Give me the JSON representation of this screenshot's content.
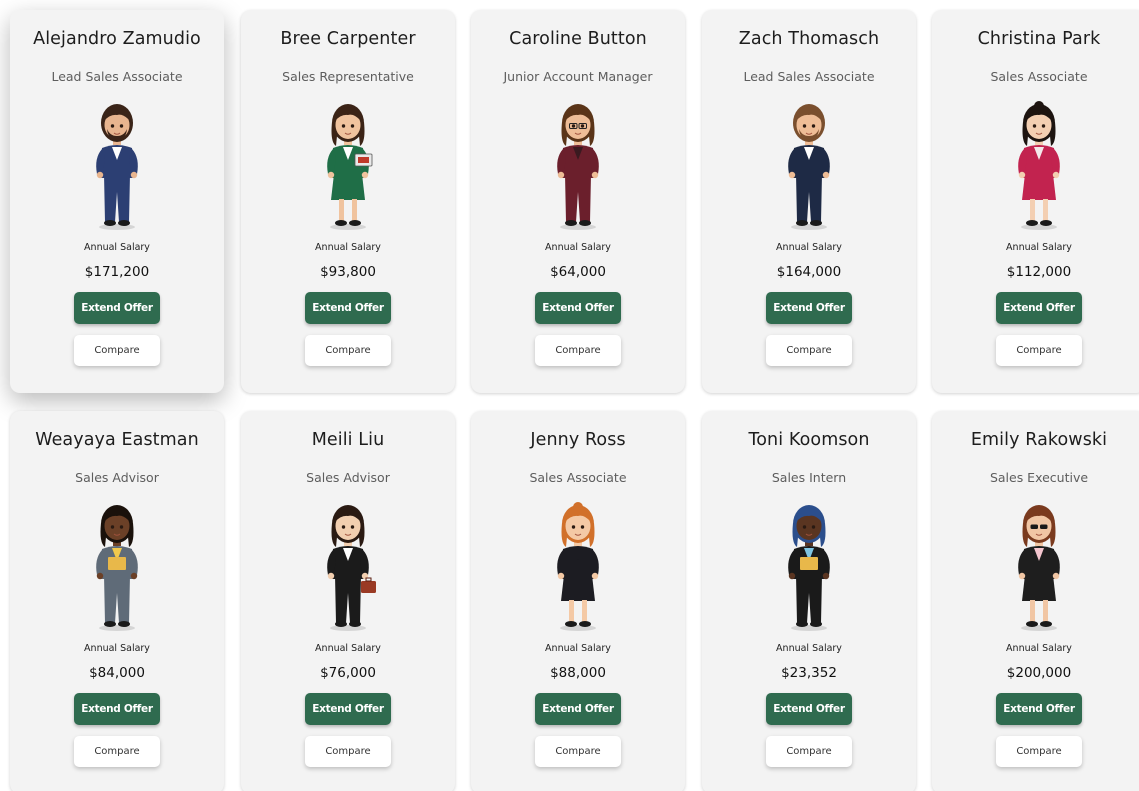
{
  "labels": {
    "salary_label": "Annual Salary",
    "offer_button": "Extend Offer",
    "compare_button": "Compare"
  },
  "colors": {
    "card_bg": "#f3f3f3",
    "offer_button_bg": "#2f6b4f",
    "compare_button_bg": "#ffffff"
  },
  "candidates": [
    {
      "name": "Alejandro Zamudio",
      "role": "Lead Sales Associate",
      "salary": "$171,200",
      "avatar": "man-beard-blue-suit",
      "hovered": true,
      "look": {
        "skin": "#e8b58f",
        "hair": "#3a2418",
        "outfit": "#2c3f73",
        "shirt": "#ffffff",
        "style": "suit",
        "extra": "beard"
      }
    },
    {
      "name": "Bree Carpenter",
      "role": "Sales Representative",
      "salary": "$93,800",
      "avatar": "woman-bun-green-suit",
      "hovered": false,
      "look": {
        "skin": "#f0c39e",
        "hair": "#3b2316",
        "outfit": "#1f6e47",
        "shirt": "#ffffff",
        "style": "skirt",
        "extra": "laptop"
      }
    },
    {
      "name": "Caroline Button",
      "role": "Junior Account Manager",
      "salary": "$64,000",
      "avatar": "woman-glasses-burgundy-suit",
      "hovered": false,
      "look": {
        "skin": "#eebd97",
        "hair": "#5a3418",
        "outfit": "#6b1f2c",
        "shirt": "#3a1a20",
        "style": "suit",
        "extra": "glasses"
      }
    },
    {
      "name": "Zach Thomasch",
      "role": "Lead Sales Associate",
      "salary": "$164,000",
      "avatar": "man-navy-suit",
      "hovered": false,
      "look": {
        "skin": "#efbd96",
        "hair": "#7a4f2e",
        "outfit": "#1e2a45",
        "shirt": "#ffffff",
        "style": "suit",
        "extra": "beard"
      }
    },
    {
      "name": "Christina Park",
      "role": "Sales Associate",
      "salary": "$112,000",
      "avatar": "woman-pink-suit",
      "hovered": false,
      "look": {
        "skin": "#f3cfb2",
        "hair": "#1d1410",
        "outfit": "#c2234f",
        "shirt": "#f4e8ea",
        "style": "skirt",
        "extra": "none"
      }
    },
    {
      "name": "Weayaya Eastman",
      "role": "Sales Advisor",
      "salary": "$84,000",
      "avatar": "woman-braids-grey-suit",
      "hovered": false,
      "look": {
        "skin": "#6b4027",
        "hair": "#1a110b",
        "outfit": "#5f6b78",
        "shirt": "#f2c94c",
        "style": "suit",
        "extra": "folder"
      }
    },
    {
      "name": "Meili Liu",
      "role": "Sales Advisor",
      "salary": "$76,000",
      "avatar": "woman-black-suit-briefcase",
      "hovered": false,
      "look": {
        "skin": "#f2cfb0",
        "hair": "#2a1a12",
        "outfit": "#1b1b1b",
        "shirt": "#ffffff",
        "style": "suit",
        "extra": "briefcase"
      }
    },
    {
      "name": "Jenny Ross",
      "role": "Sales Associate",
      "salary": "$88,000",
      "avatar": "woman-red-hair-black-dress",
      "hovered": false,
      "look": {
        "skin": "#f4c9a5",
        "hair": "#d1702a",
        "outfit": "#1c1c22",
        "shirt": "#1c1c22",
        "style": "skirt",
        "extra": "none"
      }
    },
    {
      "name": "Toni Koomson",
      "role": "Sales Intern",
      "salary": "$23,352",
      "avatar": "woman-headband-blue-shirt",
      "hovered": false,
      "look": {
        "skin": "#5a3521",
        "hair": "#2b4e8c",
        "outfit": "#1a1a1a",
        "shirt": "#7fc5e3",
        "style": "suit",
        "extra": "folder"
      }
    },
    {
      "name": "Emily Rakowski",
      "role": "Sales Executive",
      "salary": "$200,000",
      "avatar": "woman-sunglasses-pink-blouse",
      "hovered": false,
      "look": {
        "skin": "#f1c6a4",
        "hair": "#7a3a1e",
        "outfit": "#1e1e1e",
        "shirt": "#f4c6cf",
        "style": "skirt",
        "extra": "sunglasses"
      }
    }
  ]
}
